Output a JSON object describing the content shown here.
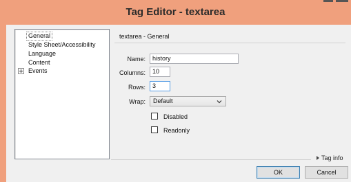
{
  "window": {
    "title": "Tag Editor - textarea"
  },
  "sidebar": {
    "items": [
      {
        "label": "General",
        "selected": true
      },
      {
        "label": "Style Sheet/Accessibility"
      },
      {
        "label": "Language"
      },
      {
        "label": "Content"
      },
      {
        "label": "Events",
        "expandable": true
      }
    ]
  },
  "section": {
    "title": "textarea - General"
  },
  "form": {
    "name": {
      "label": "Name:",
      "value": "history"
    },
    "columns": {
      "label": "Columns:",
      "value": "10"
    },
    "rows": {
      "label": "Rows:",
      "value": "3"
    },
    "wrap": {
      "label": "Wrap:",
      "value": "Default"
    },
    "disabled": {
      "label": "Disabled",
      "checked": false
    },
    "readonly": {
      "label": "Readonly",
      "checked": false
    }
  },
  "footer": {
    "tag_info": "Tag info",
    "ok": "OK",
    "cancel": "Cancel"
  },
  "colors": {
    "titlebar": "#f0a07d",
    "focus_border": "#569de5"
  }
}
